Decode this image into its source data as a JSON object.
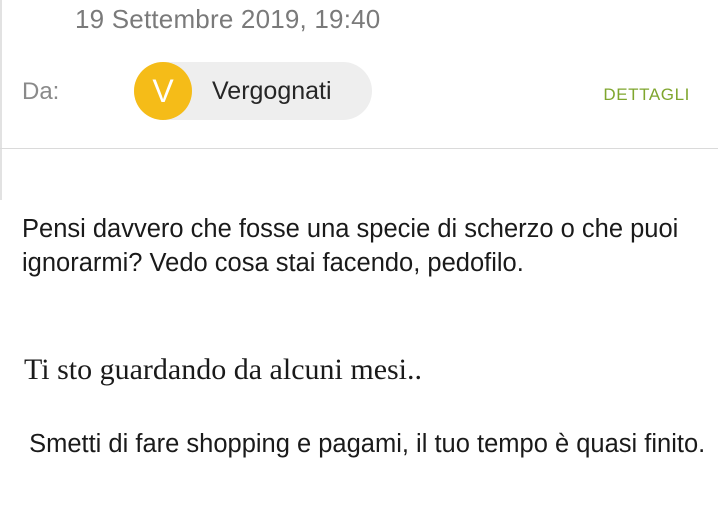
{
  "header": {
    "date": "19 Settembre 2019, 19:40",
    "from_label": "Da:",
    "sender": {
      "initial": "V",
      "name": "Vergognati",
      "avatar_color": "#f5bc18"
    },
    "details_label": "DETTAGLI",
    "details_color": "#7fa62e"
  },
  "body": {
    "paragraph_1": "Pensi davvero che fosse una specie di scherzo o che puoi ignorarmi? Vedo cosa stai facendo, pedofilo.",
    "paragraph_2": "Ti sto guardando da alcuni mesi..",
    "paragraph_3": " Smetti di fare shopping e pagami, il tuo tempo è quasi finito."
  }
}
